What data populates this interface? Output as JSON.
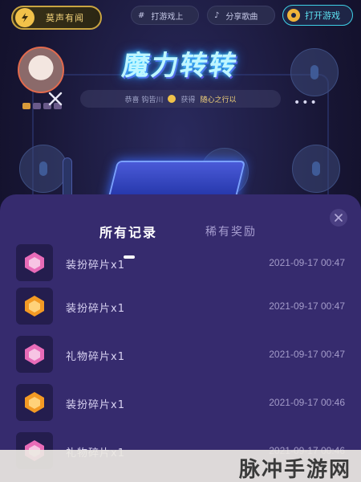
{
  "room": {
    "name": "莫声有闻",
    "chip_left": "打游戏上",
    "chip_right": "分享歌曲",
    "open_game": "打开游戏",
    "title": "魔力转转",
    "marquee_prefix": "恭喜 钩皆川",
    "marquee_action": "获得",
    "marquee_prize": "随心之行以"
  },
  "sheet": {
    "tabs": [
      {
        "label": "所有记录"
      },
      {
        "label": "稀有奖励"
      }
    ],
    "records": [
      {
        "name": "装扮碎片x1",
        "time": "2021-09-17 00:47",
        "icon": "orange-gem-icon"
      },
      {
        "name": "装扮碎片x1",
        "time": "2021-09-17 00:47",
        "icon": "orange-gem-icon"
      },
      {
        "name": "礼物碎片x1",
        "time": "2021-09-17 00:47",
        "icon": "pink-gem-icon"
      },
      {
        "name": "装扮碎片x1",
        "time": "2021-09-17 00:46",
        "icon": "orange-gem-icon"
      },
      {
        "name": "礼物碎片x1",
        "time": "2021-09-17 00:46",
        "icon": "pink-gem-icon"
      }
    ]
  },
  "watermark": {
    "text": "脉冲手游网"
  },
  "colors": {
    "sheet_bg": "#362b6e",
    "accent_cyan": "#5ee3f2",
    "gold": "#f2c24a",
    "gem_orange": "#f39a24",
    "gem_pink": "#e86bb8"
  }
}
